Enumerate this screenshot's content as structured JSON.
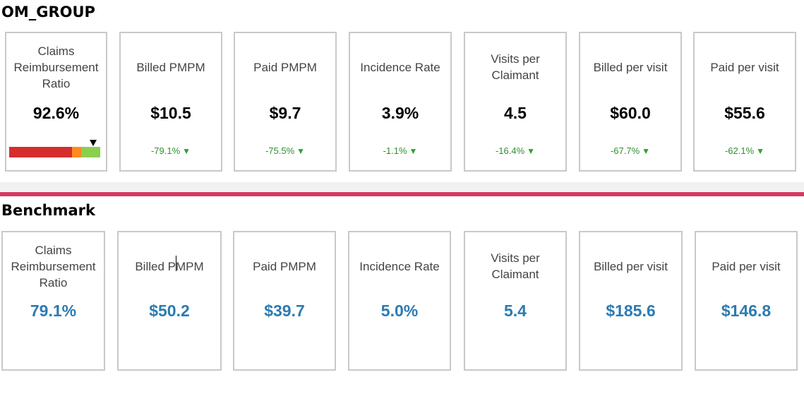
{
  "om_group": {
    "title": "OM_GROUP",
    "cards": [
      {
        "label": "Claims Reimbursement Ratio",
        "value": "92.6%",
        "gauge": {
          "value_percent": 92.6,
          "red_fraction": 0.69,
          "orange_fraction": 0.1,
          "green_fraction": 0.21
        }
      },
      {
        "label": "Billed PMPM",
        "value": "$10.5",
        "delta": "-79.1%"
      },
      {
        "label": "Paid PMPM",
        "value": "$9.7",
        "delta": "-75.5%"
      },
      {
        "label": "Incidence Rate",
        "value": "3.9%",
        "delta": "-1.1%"
      },
      {
        "label": "Visits per Claimant",
        "value": "4.5",
        "delta": "-16.4%"
      },
      {
        "label": "Billed per visit",
        "value": "$60.0",
        "delta": "-67.7%"
      },
      {
        "label": "Paid per visit",
        "value": "$55.6",
        "delta": "-62.1%"
      }
    ]
  },
  "benchmark": {
    "title": "Benchmark",
    "cards": [
      {
        "label": "Claims Reimbursement Ratio",
        "value": "79.1%"
      },
      {
        "label": "Billed PMPM",
        "value": "$50.2"
      },
      {
        "label": "Paid PMPM",
        "value": "$39.7"
      },
      {
        "label": "Incidence Rate",
        "value": "5.0%"
      },
      {
        "label": "Visits per Claimant",
        "value": "5.4"
      },
      {
        "label": "Billed per visit",
        "value": "$185.6"
      },
      {
        "label": "Paid per visit",
        "value": "$146.8"
      }
    ]
  },
  "colors": {
    "divider": "#d53b62",
    "benchmark_value": "#2b7bb1",
    "delta_down": "#2f8f2f",
    "gauge_red": "#d62d2d",
    "gauge_orange": "#ff8a1e",
    "gauge_green": "#8ccf4f"
  },
  "icons": {
    "delta_indicator": "triangle-down-icon",
    "gauge_marker": "triangle-down-icon"
  }
}
